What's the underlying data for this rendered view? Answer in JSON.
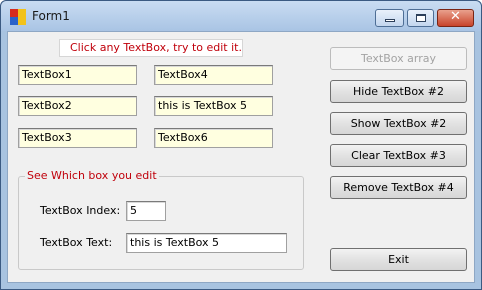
{
  "window": {
    "title": "Form1"
  },
  "hint": "Click any TextBox, try to edit it...",
  "textboxes": {
    "tb1": "TextBox1",
    "tb2": "TextBox2",
    "tb3": "TextBox3",
    "tb4": "TextBox4",
    "tb5": "this is TextBox 5",
    "tb6": "TextBox6"
  },
  "buttons": {
    "textbox_array": "TextBox array",
    "hide_tb2": "Hide TextBox #2",
    "show_tb2": "Show TextBox #2",
    "clear_tb3": "Clear TextBox #3",
    "remove_tb4": "Remove TextBox #4",
    "exit": "Exit"
  },
  "group": {
    "title": "See Which box you edit",
    "index_label": "TextBox Index:",
    "index_value": "5",
    "text_label": "TextBox Text:",
    "text_value": "this is TextBox 5"
  },
  "colors": {
    "accent_red": "#c0000b",
    "textbox_yellow": "#ffffe0",
    "close_red": "#c8432a"
  },
  "icons": [
    "app-icon",
    "minimize-icon",
    "maximize-icon",
    "close-icon"
  ]
}
